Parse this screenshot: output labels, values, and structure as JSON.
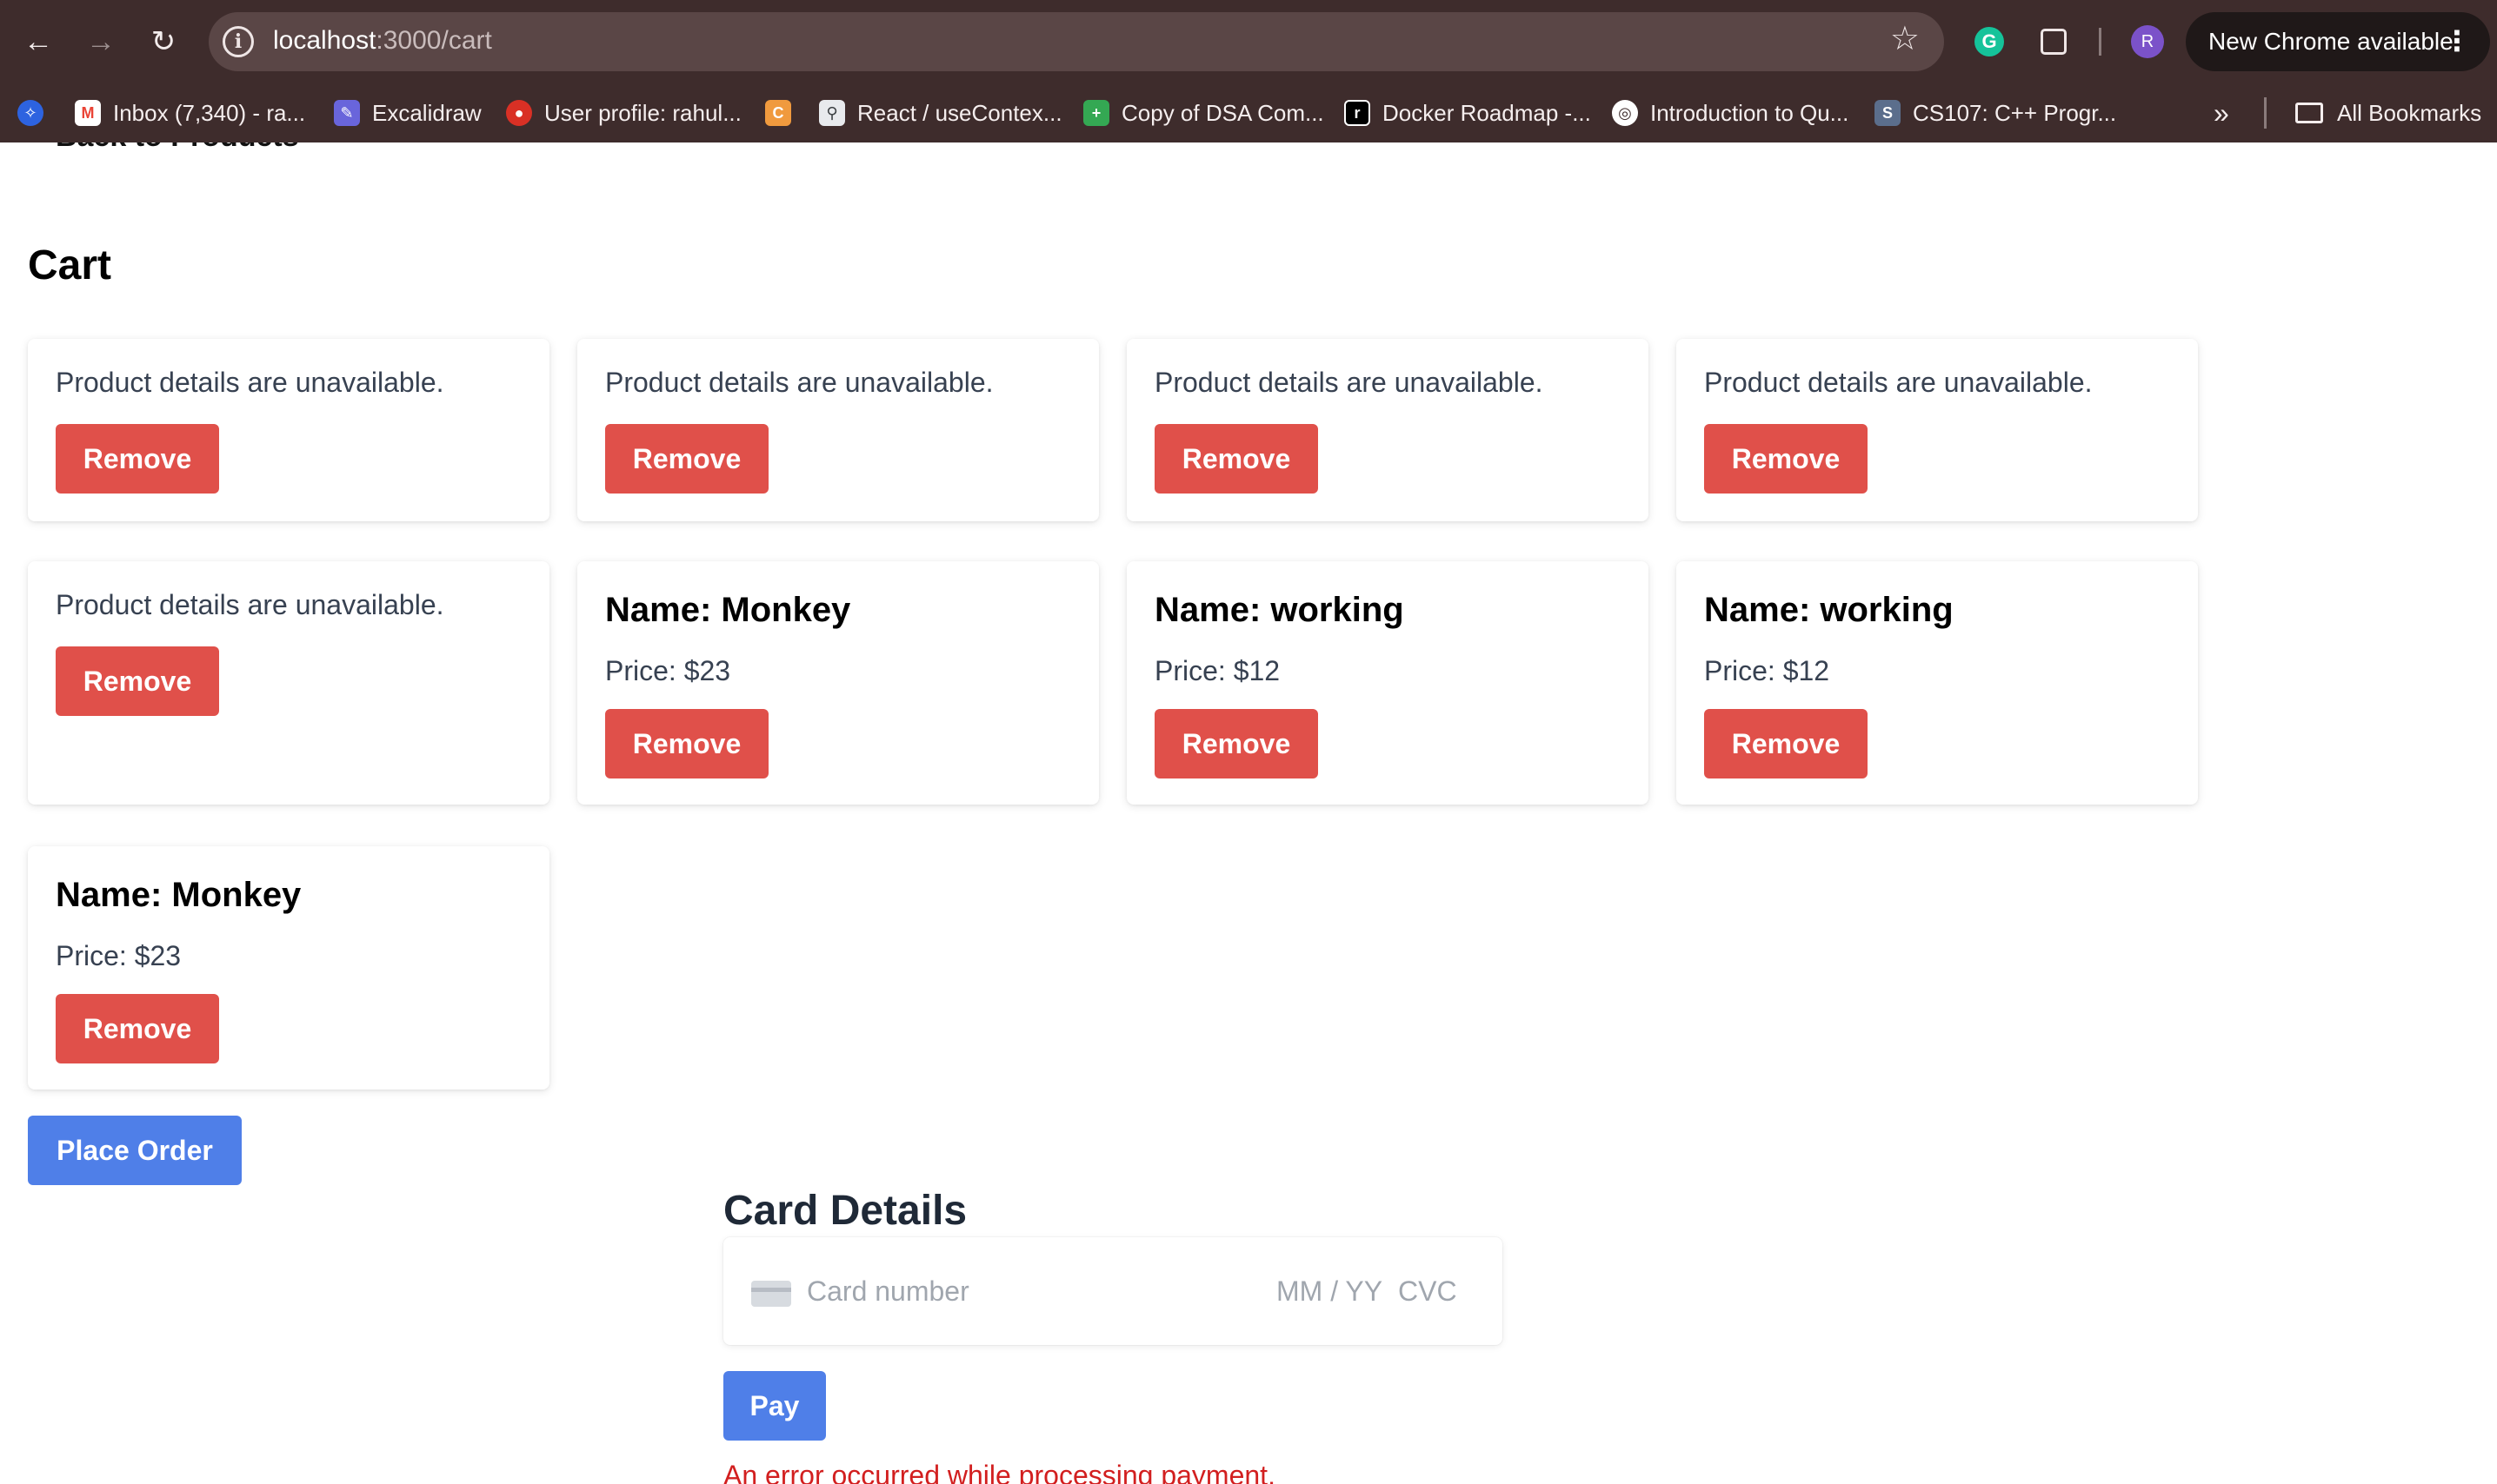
{
  "browser": {
    "url_host": "localhost",
    "url_path": ":3000/cart",
    "update_label": "New Chrome available",
    "profile_initial": "R",
    "bookmarks": [
      {
        "label": "Inbox (7,340) - ra...",
        "icon": "gmail-icon",
        "color": "#ea4335"
      },
      {
        "label": "Excalidraw",
        "icon": "excalidraw-icon",
        "color": "#6965db"
      },
      {
        "label": "User profile: rahul...",
        "icon": "profile-site-icon",
        "color": "#d93025"
      },
      {
        "label": "React / useContex...",
        "icon": "search-doc-icon",
        "color": "#9aa0a6"
      },
      {
        "label": "Copy of DSA Com...",
        "icon": "sheets-icon",
        "color": "#34a853"
      },
      {
        "label": "Docker Roadmap -...",
        "icon": "roadmap-icon",
        "color": "#000000"
      },
      {
        "label": "Introduction to Qu...",
        "icon": "globe-icon",
        "color": "#ffffff"
      },
      {
        "label": "CS107: C++ Progr...",
        "icon": "stanford-icon",
        "color": "#8c1515"
      }
    ],
    "all_bookmarks_label": "All Bookmarks"
  },
  "page": {
    "back_link": "Back to Products",
    "title": "Cart",
    "unavailable_text": "Product details are unavailable.",
    "remove_label": "Remove",
    "items": [
      {
        "name": "Name: Monkey",
        "price": "Price: $23"
      },
      {
        "name": "Name: working",
        "price": "Price: $12"
      },
      {
        "name": "Name: working",
        "price": "Price: $12"
      },
      {
        "name": "Name: Monkey",
        "price": "Price: $23"
      }
    ],
    "place_order_label": "Place Order"
  },
  "payment": {
    "title": "Card Details",
    "card_number_placeholder": "Card number",
    "expiry_placeholder": "MM / YY",
    "cvc_placeholder": "CVC",
    "pay_label": "Pay",
    "error": "An error occurred while processing payment."
  },
  "colors": {
    "remove_button": "#e0504a",
    "primary_button": "#4f7fe8",
    "error_text": "#d21f1f"
  }
}
